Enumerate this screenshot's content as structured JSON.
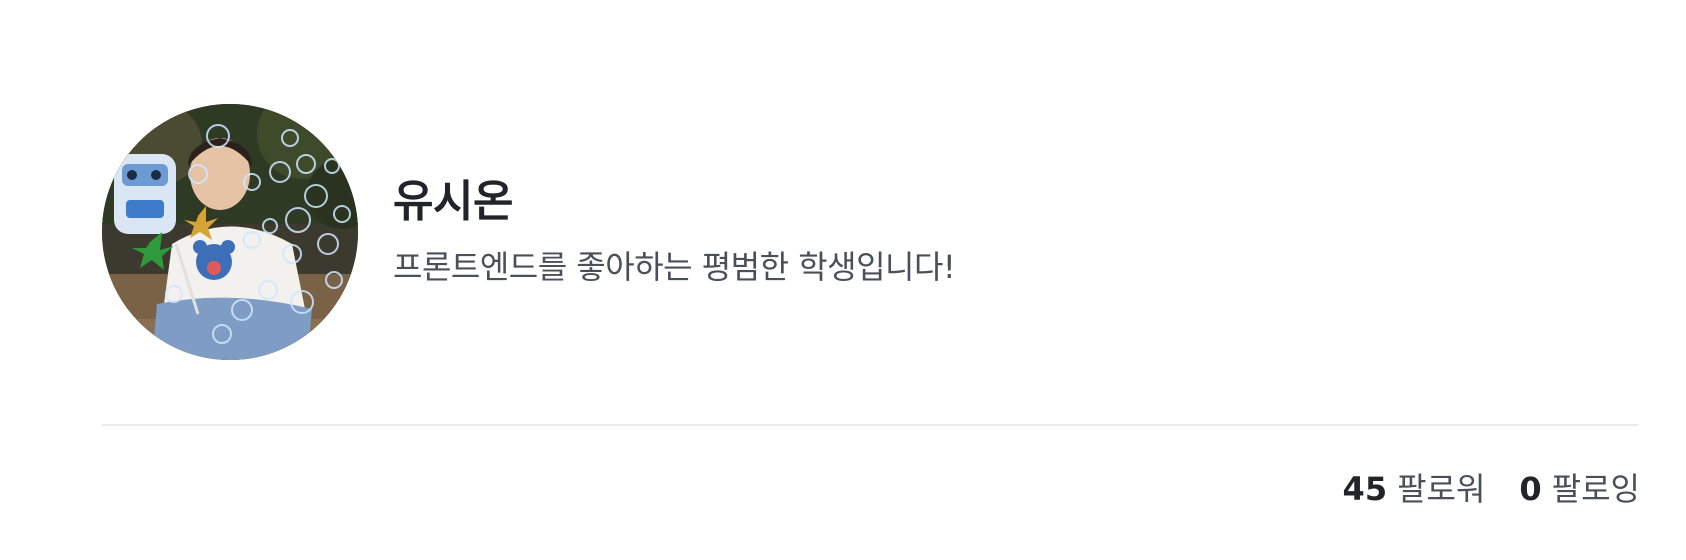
{
  "profile": {
    "name": "유시온",
    "bio": "프론트엔드를 좋아하는 평범한 학생입니다!",
    "avatar_icon": "user-photo"
  },
  "stats": {
    "followers": {
      "count": "45",
      "label": "팔로워"
    },
    "following": {
      "count": "0",
      "label": "팔로잉"
    }
  },
  "colors": {
    "name": "#212529",
    "bio": "#495057",
    "divider": "#e9ecef"
  }
}
